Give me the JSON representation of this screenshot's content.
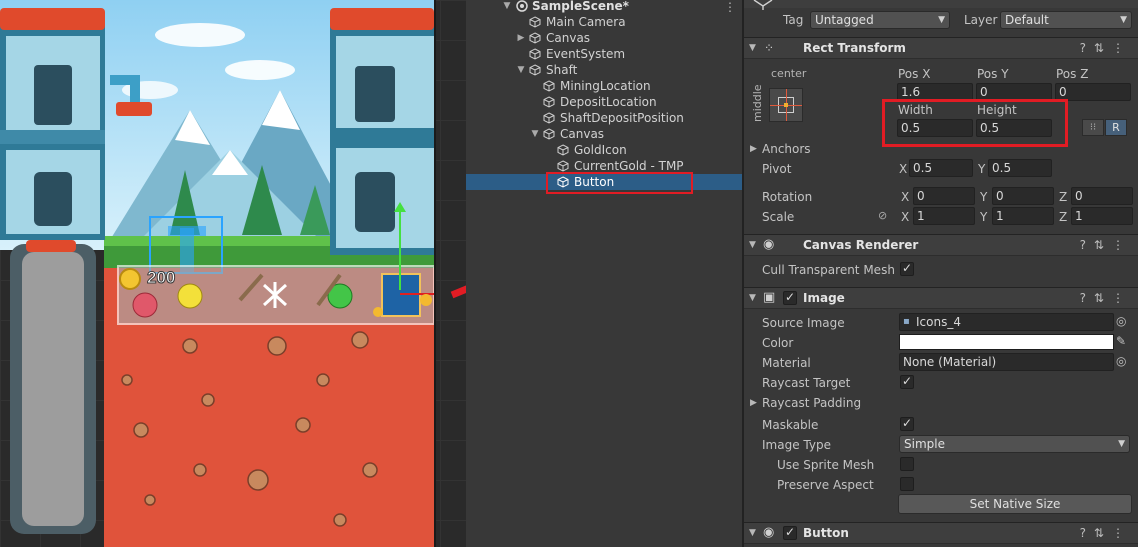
{
  "scene": {
    "gold_amount": "200"
  },
  "hierarchy": {
    "scene_name": "SampleScene*",
    "items": [
      {
        "label": "Main Camera"
      },
      {
        "label": "Canvas"
      },
      {
        "label": "EventSystem"
      },
      {
        "label": "Shaft"
      },
      {
        "label": "MiningLocation"
      },
      {
        "label": "DepositLocation"
      },
      {
        "label": "ShaftDepositPosition"
      },
      {
        "label": "Canvas"
      },
      {
        "label": "GoldIcon"
      },
      {
        "label": "CurrentGold - TMP"
      },
      {
        "label": "Button"
      }
    ],
    "selected": "Button"
  },
  "inspector": {
    "tag_label": "Tag",
    "tag_value": "Untagged",
    "layer_label": "Layer",
    "layer_value": "Default",
    "rect_transform": {
      "title": "Rect Transform",
      "anchor_h": "center",
      "anchor_v": "middle",
      "pos_x_label": "Pos X",
      "pos_y_label": "Pos Y",
      "pos_z_label": "Pos Z",
      "pos_x": "1.6",
      "pos_y": "0",
      "pos_z": "0",
      "width_label": "Width",
      "height_label": "Height",
      "width": "0.5",
      "height": "0.5",
      "r_button": "R",
      "anchors_label": "Anchors",
      "pivot_label": "Pivot",
      "pivot_x": "0.5",
      "pivot_y": "0.5",
      "rotation_label": "Rotation",
      "rotation_x": "0",
      "rotation_y": "0",
      "rotation_z": "0",
      "scale_label": "Scale",
      "scale_x": "1",
      "scale_y": "1",
      "scale_z": "1",
      "axis_x": "X",
      "axis_y": "Y",
      "axis_z": "Z"
    },
    "canvas_renderer": {
      "title": "Canvas Renderer",
      "cull_label": "Cull Transparent Mesh",
      "cull_checked": true
    },
    "image": {
      "title": "Image",
      "source_image_label": "Source Image",
      "source_image_value": "Icons_4",
      "color_label": "Color",
      "color_value": "#ffffff",
      "material_label": "Material",
      "material_value": "None (Material)",
      "raycast_target_label": "Raycast Target",
      "raycast_padding_label": "Raycast Padding",
      "maskable_label": "Maskable",
      "image_type_label": "Image Type",
      "image_type_value": "Simple",
      "use_sprite_mesh_label": "Use Sprite Mesh",
      "preserve_aspect_label": "Preserve Aspect",
      "set_native_size_label": "Set Native Size"
    },
    "button": {
      "title": "Button"
    }
  },
  "colors": {
    "selection": "#2c5d87",
    "highlight_red": "#e11c24",
    "panel_bg": "#383838"
  }
}
